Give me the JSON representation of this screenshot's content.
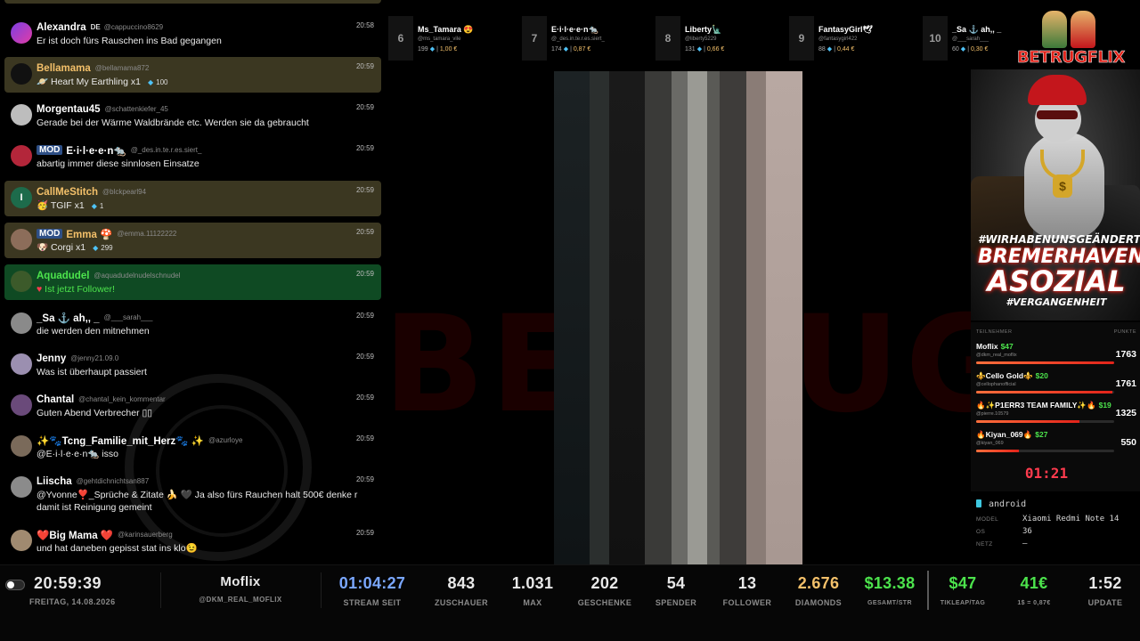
{
  "watermark": "BETRUGFLIX",
  "chat": {
    "messages": [
      {
        "name": "Alexandra",
        "flag": "DE",
        "handle": "@cappuccino8629",
        "time": "20:58",
        "text": "Er ist doch fürs Rauschen ins Bad gegangen"
      },
      {
        "name": "Bellamama",
        "handle": "@bellamama872",
        "time": "20:59",
        "gift": "Heart My Earthling x1",
        "gift_icon": "🪐",
        "diamonds": "100"
      },
      {
        "name": "Morgentau45",
        "handle": "@schattenkiefer_45",
        "time": "20:59",
        "text": "Gerade bei der Wärme Waldbrände etc. Werden sie da gebraucht"
      },
      {
        "badge": "MOD",
        "name": "E·i·l·e·e·n🐀",
        "handle": "@_des.in.te.r.es.siert_",
        "time": "20:59",
        "text": "abartig immer diese sinnlosen Einsatze"
      },
      {
        "name": "CallMeStitch",
        "handle": "@blckpearl94",
        "time": "20:59",
        "gift": "TGIF x1",
        "gift_icon": "🥳",
        "diamonds": "1",
        "avatar_letter": "I"
      },
      {
        "badge": "MOD",
        "name": "Emma 🍄",
        "handle": "@emma.11122222",
        "time": "20:59",
        "gift": "Corgi x1",
        "gift_icon": "🐶",
        "diamonds": "299"
      },
      {
        "name": "Aquadudel",
        "handle": "@aquadudelnudelschnudel",
        "time": "20:59",
        "follow_text": "Ist jetzt Follower!"
      },
      {
        "name": "_Sa ⚓ ah,, _",
        "handle": "@___sarah___",
        "time": "20:59",
        "text": "die werden den mitnehmen"
      },
      {
        "name": "Jenny",
        "handle": "@jenny21.09.0",
        "time": "20:59",
        "text": "Was ist überhaupt passiert"
      },
      {
        "name": "Chantal",
        "handle": "@chantal_kein_kommentar",
        "time": "20:59",
        "text": "Guten Abend Verbrecher ▯▯"
      },
      {
        "name": "✨🐾Tcng_Familie_mit_Herz🐾 ✨",
        "handle": "@azurloye",
        "time": "20:59",
        "text": "@E·i·l·e·e·n🐀 isso"
      },
      {
        "name": "Liischa",
        "handle": "@gehtdichnichtsan887",
        "time": "20:59",
        "text": "@Yvonne❣️_Sprüche & Zitate 🍌 🖤 Ja also fürs Rauchen halt 500€ denke r damit ist Reinigung gemeint"
      },
      {
        "name": "❤️Big Mama ❤️",
        "handle": "@karinsauerberg",
        "time": "20:59",
        "text": "und hat daneben gepisst stat ins klo😉"
      }
    ]
  },
  "top_leaderboard": [
    {
      "rank": "6",
      "name": "Ms_Tamara 😍",
      "handle": "@ms_tamara_vile",
      "diamonds": "199",
      "money": "1,00 €"
    },
    {
      "rank": "7",
      "name": "E·i·l·e·e·n🐀",
      "handle": "@_des.in.te.r.es.siert_",
      "diamonds": "174",
      "money": "0,87 €"
    },
    {
      "rank": "8",
      "name": "Liberty🗽",
      "handle": "@liberty5229",
      "diamonds": "131",
      "money": "0,66 €"
    },
    {
      "rank": "9",
      "name": "FantasyGirl🕊",
      "handle": "@fantasygirl422",
      "diamonds": "88",
      "money": "0,44 €"
    },
    {
      "rank": "10",
      "name": "_Sa ⚓ ah,, _",
      "handle": "@___sarah___",
      "diamonds": "60",
      "money": "0,30 €"
    }
  ],
  "logo": {
    "text": "BETRUGFLIX"
  },
  "artwork": {
    "tag_top": "#WIRHABENUNSGEÄNDERT",
    "line1": "BREMERHAVEN",
    "line2": "ASOZIAL",
    "tag_bottom": "#VERGANGENHEIT",
    "medal": "$"
  },
  "right_leaderboard": {
    "header_left": "TEILNEHMER",
    "header_right": "PUNKTE",
    "entries": [
      {
        "name": "Moflix",
        "amount": "$47",
        "handle": "@dkm_real_moflix",
        "points": "1763",
        "fill": 1.0
      },
      {
        "name": "⚜️Cello Gold⚜️",
        "amount": "$20",
        "handle": "@cellophanofficial",
        "points": "1761",
        "fill": 0.99
      },
      {
        "name": "🔥✨P1ERR3 TEAM FAMILY✨🔥",
        "amount": "$19",
        "handle": "@pierre.10579",
        "points": "1325",
        "fill": 0.75
      },
      {
        "name": "🔥Kiyan_069🔥",
        "amount": "$27",
        "handle": "@kiyan_069",
        "points": "550",
        "fill": 0.31
      }
    ],
    "countdown": "01:21"
  },
  "device": {
    "title": "android",
    "model_label": "MODEL",
    "model": "Xiaomi Redmi Note 14",
    "os_label": "OS",
    "os": "36",
    "net_label": "NETZ",
    "net": "—"
  },
  "bottombar": {
    "clock": "20:59:39",
    "date": "FREITAG, 14.08.2026",
    "streamer_name": "Moflix",
    "streamer_handle": "@DKM_REAL_MOFLIX",
    "stats": [
      {
        "value": "01:04:27",
        "label": "STREAM SEIT",
        "color": "#7aa7ff"
      },
      {
        "value": "843",
        "label": "ZUSCHAUER",
        "color": "#e8e8e8"
      },
      {
        "value": "1.031",
        "label": "MAX",
        "color": "#e8e8e8"
      },
      {
        "value": "202",
        "label": "GESCHENKE",
        "color": "#e8e8e8"
      },
      {
        "value": "54",
        "label": "SPENDER",
        "color": "#e8e8e8"
      },
      {
        "value": "13",
        "label": "FOLLOWER",
        "color": "#e8e8e8"
      },
      {
        "value": "2.676",
        "label": "DIAMONDS",
        "color": "#f3c06a"
      },
      {
        "value": "$13.38",
        "label": "GESAMT/STR",
        "color": "#4ce34c"
      },
      {
        "value": "$47",
        "label": "TIKLEAP/TAG",
        "color": "#4ce34c"
      },
      {
        "value": "41€",
        "label": "1$ = 0,87€",
        "color": "#4ce34c"
      },
      {
        "value": "1:52",
        "label": "UPDATE",
        "color": "#e8e8e8"
      }
    ]
  }
}
